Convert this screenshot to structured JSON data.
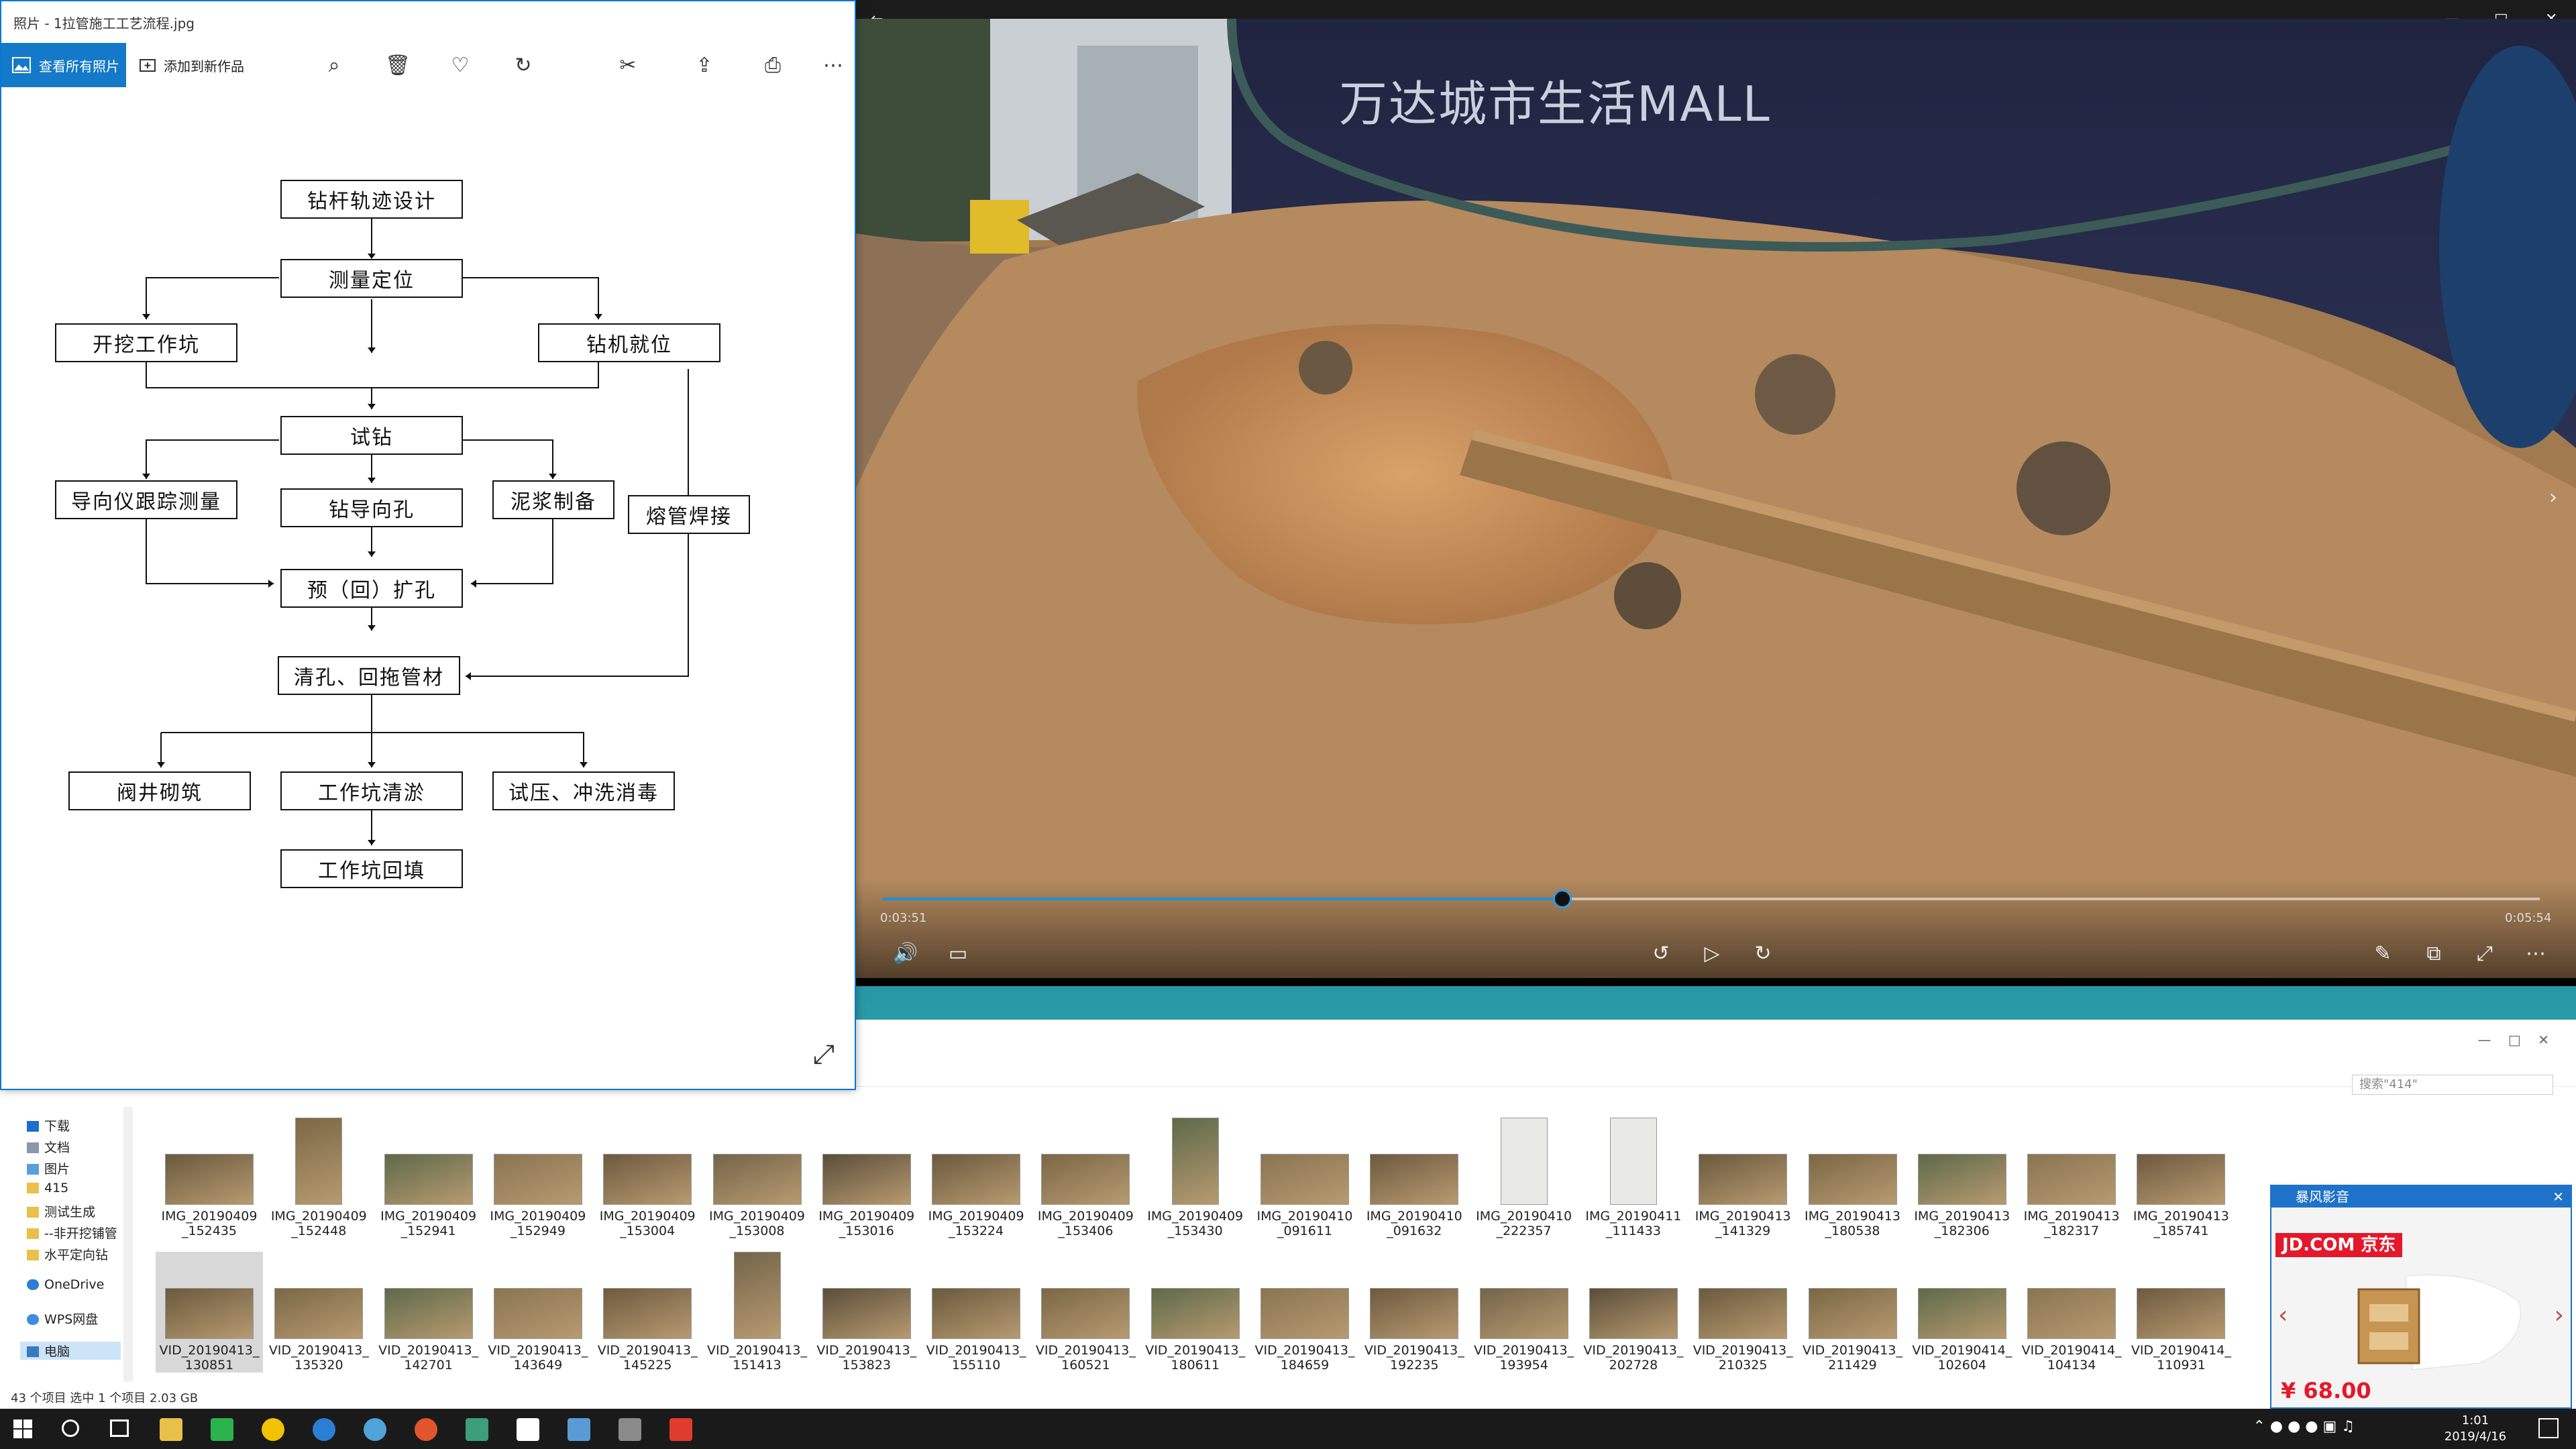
{
  "photos": {
    "title": "照片 - 1拉管施工工艺流程.jpg",
    "view_all": "查看所有照片",
    "add_to": "添加到新作品",
    "flow": {
      "design": "钻杆轨迹设计",
      "locate": "测量定位",
      "pit": "开挖工作坑",
      "rig": "钻机就位",
      "trial": "试钻",
      "guide_measure": "导向仪跟踪测量",
      "pilot": "钻导向孔",
      "mud": "泥浆制备",
      "weld": "熔管焊接",
      "ream": "预（回）扩孔",
      "pull": "清孔、回拖管材",
      "valve": "阀井砌筑",
      "clean": "工作坑清淤",
      "test": "试压、冲洗消毒",
      "backfill": "工作坑回填"
    }
  },
  "video": {
    "sign_text": "万达城市生活MALL",
    "elapsed": "0:03:51",
    "total": "0:05:54",
    "progress": 0.41
  },
  "explorer": {
    "search_placeholder": "搜索\"414\"",
    "nav": [
      "下载",
      "文档",
      "图片",
      "415",
      "测试生成",
      "--非开挖铺管",
      "水平定向钻",
      "OneDrive",
      "WPS网盘",
      "电脑"
    ],
    "row1": [
      [
        "IMG_20190409",
        "_152435"
      ],
      [
        "IMG_20190409",
        "_152448"
      ],
      [
        "IMG_20190409",
        "_152941"
      ],
      [
        "IMG_20190409",
        "_152949"
      ],
      [
        "IMG_20190409",
        "_153004"
      ],
      [
        "IMG_20190409",
        "_153008"
      ],
      [
        "IMG_20190409",
        "_153016"
      ],
      [
        "IMG_20190409",
        "_153224"
      ],
      [
        "IMG_20190409",
        "_153406"
      ],
      [
        "IMG_20190409",
        "_153430"
      ],
      [
        "IMG_20190410",
        "_091611"
      ],
      [
        "IMG_20190410",
        "_091632"
      ],
      [
        "IMG_20190410",
        "_222357"
      ],
      [
        "IMG_20190411",
        "_111433"
      ],
      [
        "IMG_20190413",
        "_141329"
      ],
      [
        "IMG_20190413",
        "_180538"
      ],
      [
        "IMG_20190413",
        "_182306"
      ],
      [
        "IMG_20190413",
        "_182317"
      ],
      [
        "IMG_20190413",
        "_185741"
      ]
    ],
    "row2": [
      [
        "VID_20190413_",
        "130851"
      ],
      [
        "VID_20190413_",
        "135320"
      ],
      [
        "VID_20190413_",
        "142701"
      ],
      [
        "VID_20190413_",
        "143649"
      ],
      [
        "VID_20190413_",
        "145225"
      ],
      [
        "VID_20190413_",
        "151413"
      ],
      [
        "VID_20190413_",
        "153823"
      ],
      [
        "VID_20190413_",
        "155110"
      ],
      [
        "VID_20190413_",
        "160521"
      ],
      [
        "VID_20190413_",
        "180611"
      ],
      [
        "VID_20190413_",
        "184659"
      ],
      [
        "VID_20190413_",
        "192235"
      ],
      [
        "VID_20190413_",
        "193954"
      ],
      [
        "VID_20190413_",
        "202728"
      ],
      [
        "VID_20190413_",
        "210325"
      ],
      [
        "VID_20190413_",
        "211429"
      ],
      [
        "VID_20190414_",
        "102604"
      ],
      [
        "VID_20190414_",
        "104134"
      ],
      [
        "VID_20190414_",
        "110931"
      ]
    ],
    "status": "43 个项目    选中 1 个项目  2.03 GB"
  },
  "ad": {
    "title": "暴风影音",
    "brand": "JD.COM 京东",
    "price": "¥ 68.00"
  },
  "taskbar": {
    "time": "1:01",
    "date": "2019/4/16"
  },
  "colors": {
    "accent": "#0078d7",
    "seek": "#1e90d6",
    "ad_red": "#e4182a"
  }
}
